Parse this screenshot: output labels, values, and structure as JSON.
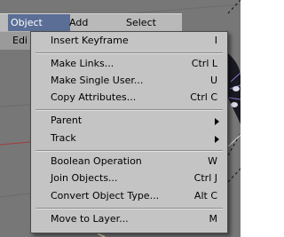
{
  "menubar": {
    "items": [
      "Object",
      "Add",
      "Select"
    ],
    "active": "Object"
  },
  "partial_label": "Edi",
  "dropdown": {
    "items": [
      {
        "label": "Insert Keyframe",
        "shortcut": "I"
      },
      {
        "label": "Make Links...",
        "shortcut": "Ctrl L"
      },
      {
        "label": "Make Single User...",
        "shortcut": "U"
      },
      {
        "label": "Copy Attributes...",
        "shortcut": "Ctrl C"
      },
      {
        "label": "Parent",
        "submenu": true
      },
      {
        "label": "Track",
        "submenu": true
      },
      {
        "label": "Boolean Operation",
        "shortcut": "W"
      },
      {
        "label": "Join Objects...",
        "shortcut": "Ctrl J"
      },
      {
        "label": "Convert Object Type...",
        "shortcut": "Alt C"
      },
      {
        "label": "Move to Layer...",
        "shortcut": "M"
      }
    ]
  },
  "colors": {
    "menu_bg": "#c4c4c4",
    "menubar_bg": "#b9b9b9",
    "active_bg": "#5a6e96",
    "viewport_bg": "#777777"
  }
}
